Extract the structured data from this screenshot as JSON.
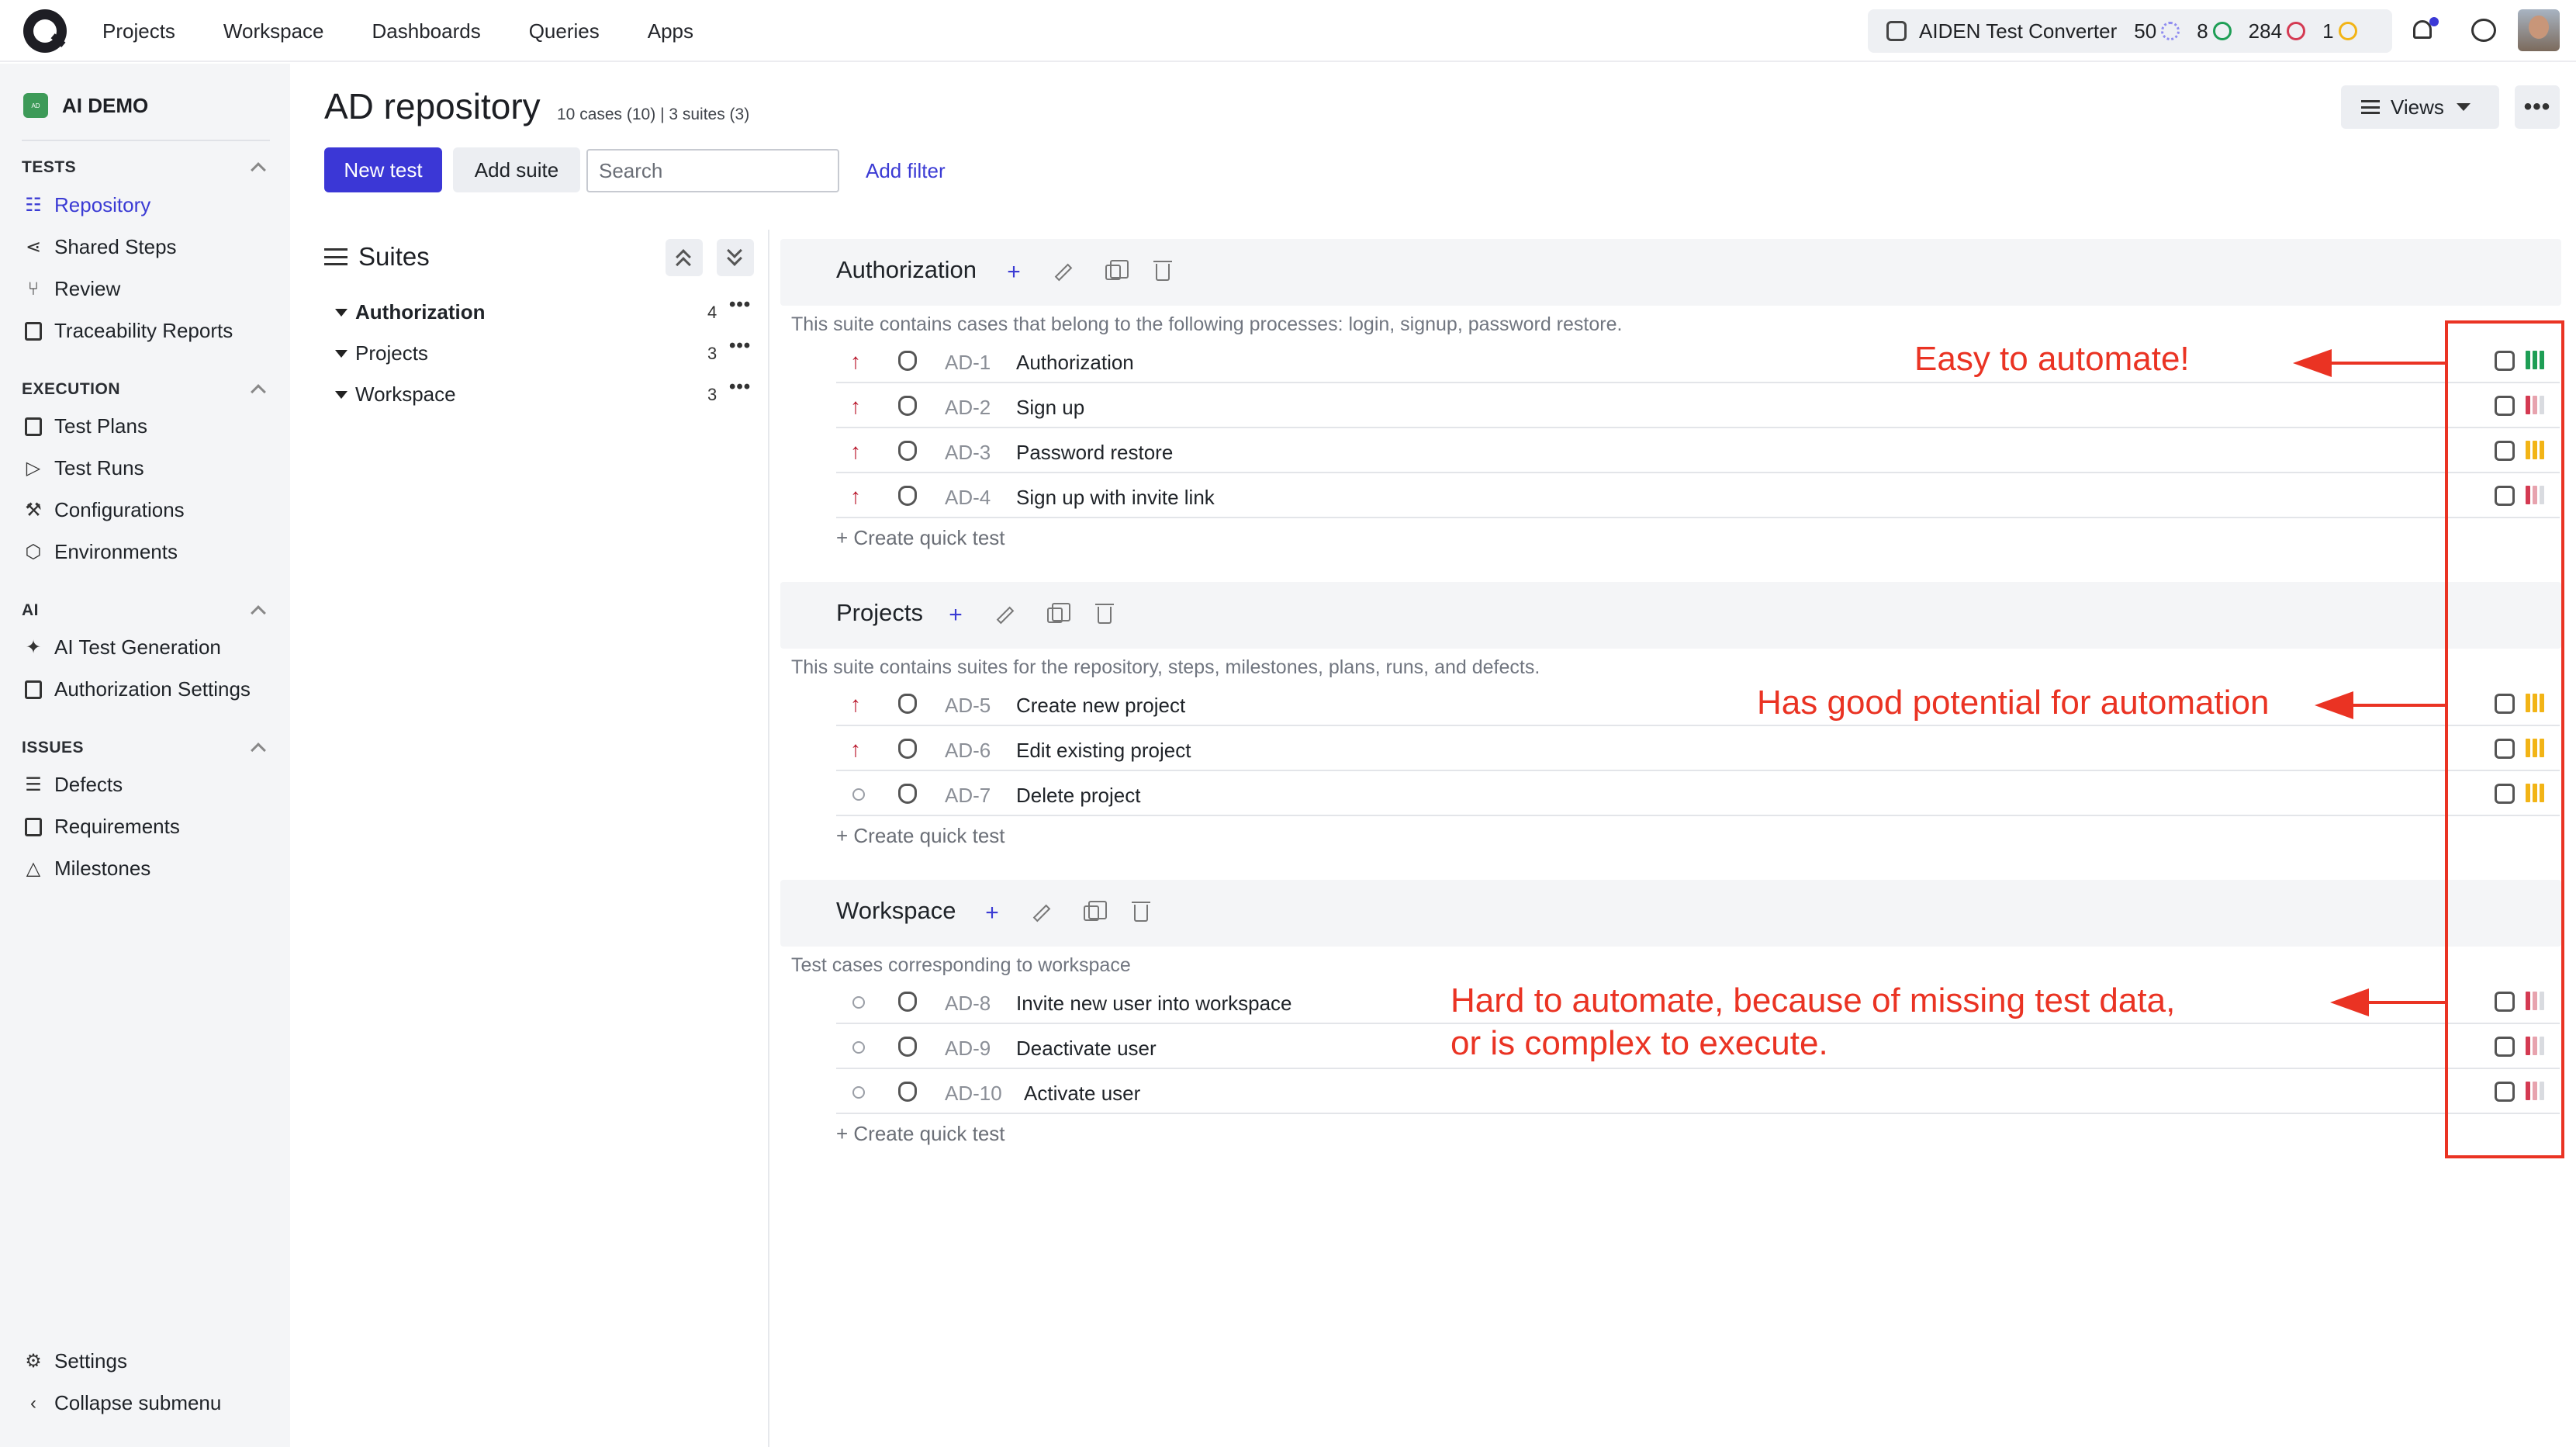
{
  "topnav": {
    "items": [
      "Projects",
      "Workspace",
      "Dashboards",
      "Queries",
      "Apps"
    ]
  },
  "aiden": {
    "label": "AIDEN Test Converter",
    "count_pending": "50",
    "count_passed": "8",
    "count_failed": "284",
    "count_paused": "1"
  },
  "colors": {
    "accent": "#3b37d6",
    "annotation": "#ea3323",
    "priority_high": "#b8152a",
    "bar_green": "#1e9e55",
    "bar_yellow": "#f2b416",
    "bar_red": "#d43a52"
  },
  "sidebar": {
    "project_name": "AI DEMO",
    "project_badge": "AD",
    "sections": [
      {
        "title": "TESTS",
        "items": [
          "Repository",
          "Shared Steps",
          "Review",
          "Traceability Reports"
        ]
      },
      {
        "title": "EXECUTION",
        "items": [
          "Test Plans",
          "Test Runs",
          "Configurations",
          "Environments"
        ]
      },
      {
        "title": "AI",
        "items": [
          "AI Test Generation",
          "Authorization Settings"
        ]
      },
      {
        "title": "ISSUES",
        "items": [
          "Defects",
          "Requirements",
          "Milestones"
        ]
      }
    ],
    "settings": "Settings",
    "collapse": "Collapse submenu"
  },
  "header": {
    "title": "AD repository",
    "subtitle": "10 cases (10) | 3 suites (3)",
    "new_test": "New test",
    "add_suite": "Add suite",
    "search_placeholder": "Search",
    "add_filter": "Add filter",
    "views": "Views",
    "more": "•••"
  },
  "suites_panel": {
    "title": "Suites",
    "items": [
      {
        "name": "Authorization",
        "count": "4"
      },
      {
        "name": "Projects",
        "count": "3"
      },
      {
        "name": "Workspace",
        "count": "3"
      }
    ],
    "more": "•••"
  },
  "suites": [
    {
      "name": "Authorization",
      "description": "This suite contains cases that belong to the following processes: login, signup, password restore.",
      "cases": [
        {
          "id": "AD-1",
          "title": "Authorization",
          "priority": "high",
          "automation": "green"
        },
        {
          "id": "AD-2",
          "title": "Sign up",
          "priority": "high",
          "automation": "red"
        },
        {
          "id": "AD-3",
          "title": "Password restore",
          "priority": "high",
          "automation": "yellow"
        },
        {
          "id": "AD-4",
          "title": "Sign up with invite link",
          "priority": "high",
          "automation": "red"
        }
      ]
    },
    {
      "name": "Projects",
      "description": "This suite contains suites for the repository, steps, milestones, plans, runs, and defects.",
      "cases": [
        {
          "id": "AD-5",
          "title": "Create new project",
          "priority": "high",
          "automation": "yellow"
        },
        {
          "id": "AD-6",
          "title": "Edit existing project",
          "priority": "high",
          "automation": "yellow"
        },
        {
          "id": "AD-7",
          "title": "Delete project",
          "priority": "none",
          "automation": "yellow"
        }
      ]
    },
    {
      "name": "Workspace",
      "description": "Test cases corresponding to workspace",
      "cases": [
        {
          "id": "AD-8",
          "title": "Invite new user into workspace",
          "priority": "none",
          "automation": "red"
        },
        {
          "id": "AD-9",
          "title": "Deactivate user",
          "priority": "none",
          "automation": "red"
        },
        {
          "id": "AD-10",
          "title": "Activate user",
          "priority": "none",
          "automation": "red"
        }
      ]
    }
  ],
  "quick_test": "+ Create quick test",
  "annotations": {
    "easy": "Easy to automate!",
    "good": "Has good potential for automation",
    "hard_line1": "Hard to automate, because of missing test data,",
    "hard_line2": "or is complex to execute."
  }
}
